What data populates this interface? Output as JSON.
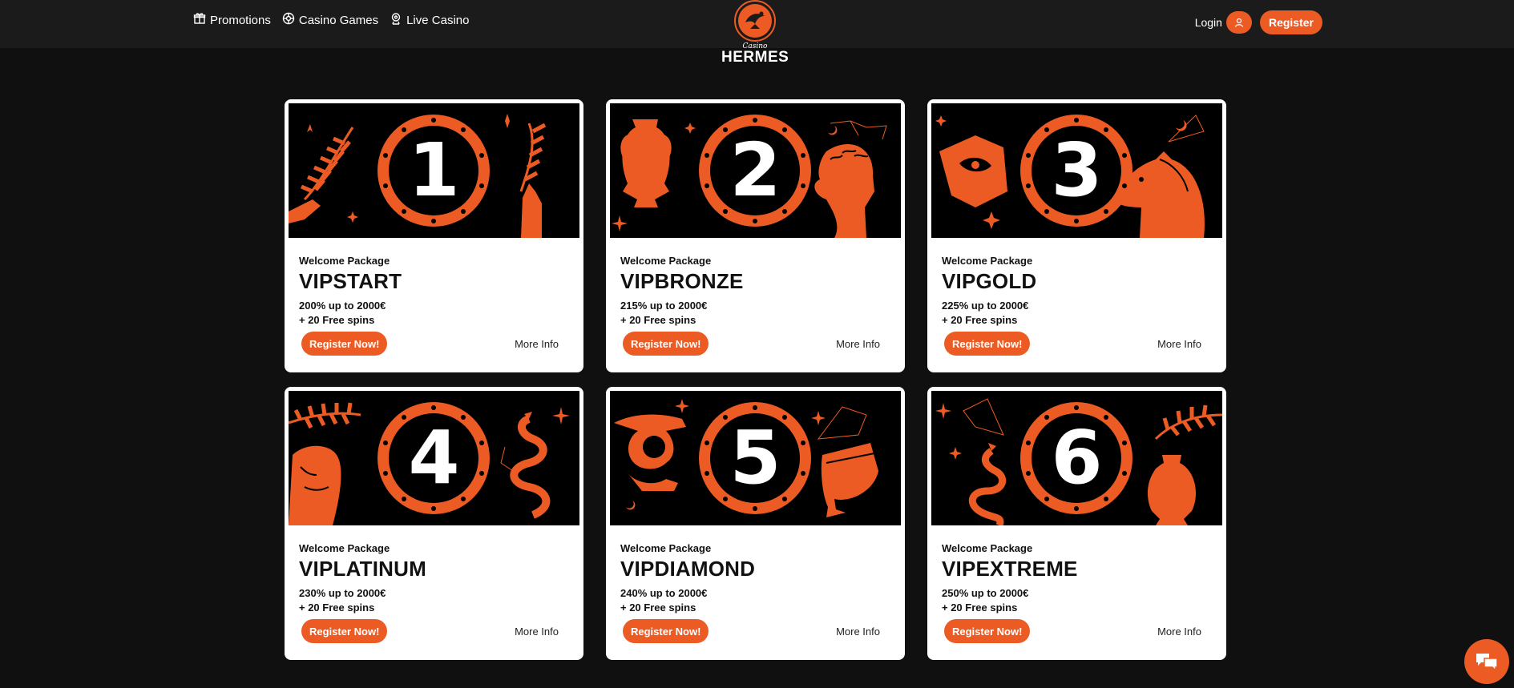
{
  "header": {
    "nav": [
      {
        "label": "Promotions",
        "icon": "gift-icon"
      },
      {
        "label": "Casino Games",
        "icon": "casino-chip-icon"
      },
      {
        "label": "Live Casino",
        "icon": "dealer-icon"
      }
    ],
    "logo": {
      "small": "Casino",
      "big": "HERMES"
    },
    "login_label": "Login",
    "register_label": "Register"
  },
  "colors": {
    "accent": "#ec5b24",
    "background": "#101010",
    "header": "#1b1b1b",
    "card": "#ffffff"
  },
  "cards": [
    {
      "number": "1",
      "eyebrow": "Welcome Package",
      "title": "VIPSTART",
      "offer": "200% up to 2000€",
      "spins": "+ 20 Free spins",
      "cta": "Register Now!",
      "more": "More Info"
    },
    {
      "number": "2",
      "eyebrow": "Welcome Package",
      "title": "VIPBRONZE",
      "offer": "215% up to 2000€",
      "spins": "+ 20 Free spins",
      "cta": "Register Now!",
      "more": "More Info"
    },
    {
      "number": "3",
      "eyebrow": "Welcome Package",
      "title": "VIPGOLD",
      "offer": "225% up to 2000€",
      "spins": "+ 20 Free spins",
      "cta": "Register Now!",
      "more": "More Info"
    },
    {
      "number": "4",
      "eyebrow": "Welcome Package",
      "title": "VIPLATINUM",
      "offer": "230% up to 2000€",
      "spins": "+ 20 Free spins",
      "cta": "Register Now!",
      "more": "More Info"
    },
    {
      "number": "5",
      "eyebrow": "Welcome Package",
      "title": "VIPDIAMOND",
      "offer": "240% up to 2000€",
      "spins": "+ 20 Free spins",
      "cta": "Register Now!",
      "more": "More Info"
    },
    {
      "number": "6",
      "eyebrow": "Welcome Package",
      "title": "VIPEXTREME",
      "offer": "250% up to 2000€",
      "spins": "+ 20 Free spins",
      "cta": "Register Now!",
      "more": "More Info"
    }
  ],
  "chat": {
    "icon": "chat-bubbles-icon"
  }
}
